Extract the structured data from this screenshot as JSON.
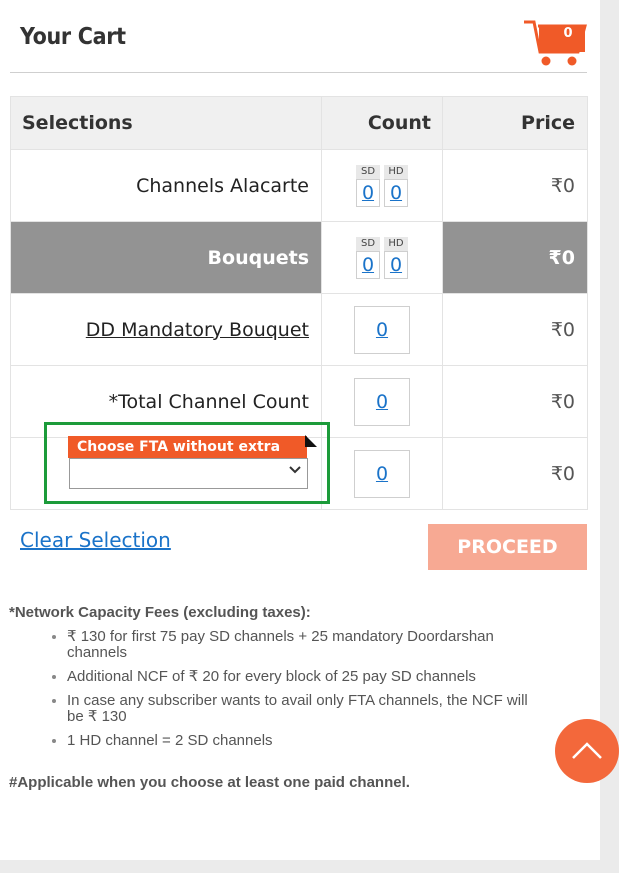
{
  "header": {
    "title": "Your Cart",
    "cart_count": "0"
  },
  "table": {
    "headers": {
      "selections": "Selections",
      "count": "Count",
      "price": "Price"
    },
    "rows": [
      {
        "label": "Channels Alacarte",
        "sd_tag": "SD",
        "hd_tag": "HD",
        "sd": "0",
        "hd": "0",
        "price": "₹0"
      },
      {
        "label": "Bouquets",
        "sd_tag": "SD",
        "hd_tag": "HD",
        "sd": "0",
        "hd": "0",
        "price": "₹0"
      },
      {
        "label": "DD Mandatory Bouquet",
        "count": "0",
        "price": "₹0"
      },
      {
        "label": "*Total Channel Count",
        "count": "0",
        "price": "₹0"
      },
      {
        "fta_label": "Choose FTA without extra cost#",
        "count": "0",
        "price": "₹0"
      }
    ]
  },
  "actions": {
    "clear": "Clear Selection",
    "proceed": "PROCEED"
  },
  "notes": {
    "title": "*Network Capacity Fees (excluding taxes):",
    "items": [
      "₹ 130 for first 75 pay SD channels + 25 mandatory Doordarshan channels",
      "Additional NCF of ₹ 20 for every block of 25 pay SD channels",
      "In case any subscriber wants to avail only FTA channels, the NCF will be ₹ 130",
      "1 HD channel = 2 SD channels"
    ],
    "applicable": "#Applicable when you choose at least one paid channel."
  },
  "colors": {
    "accent": "#f05a28",
    "link": "#1a73c9",
    "highlight": "#1c9b3a"
  }
}
